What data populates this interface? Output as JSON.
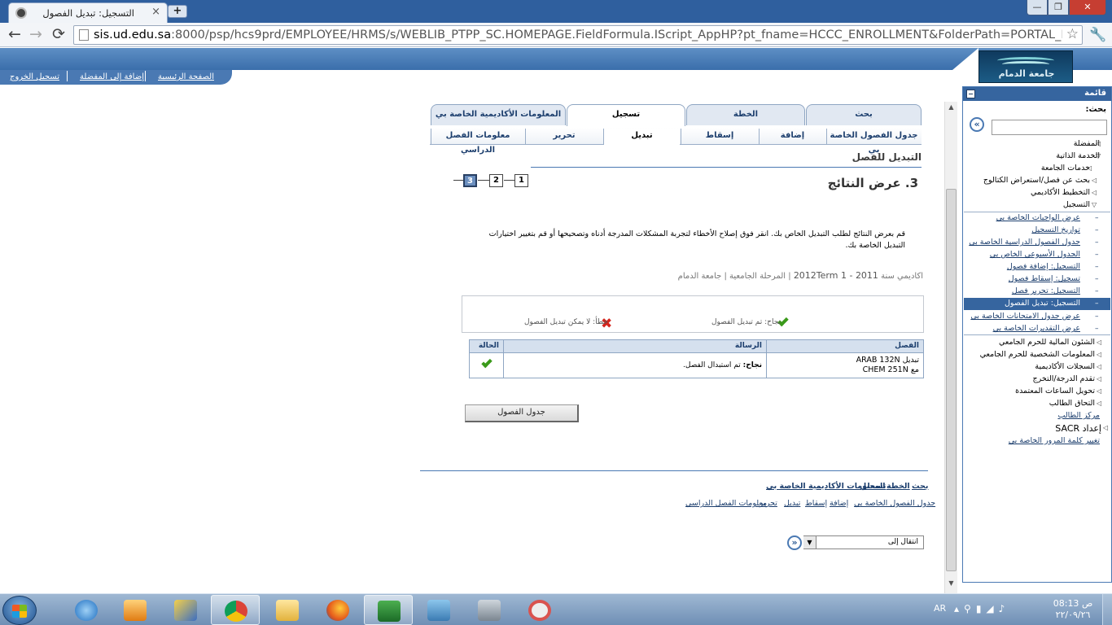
{
  "browser": {
    "tab_title": "التسجيل: تبديل الفصول",
    "new_tab": "+",
    "window_buttons": {
      "minimize": "—",
      "maximize": "❐",
      "close": "✕"
    },
    "url_host": "sis.ud.edu.sa",
    "url_rest": ":8000/psp/hcs9prd/EMPLOYEE/HRMS/s/WEBLIB_PTPP_SC.HOMEPAGE.FieldFormula.IScript_AppHP?pt_fname=HCCC_ENROLLMENT&FolderPath=PORTAL_ROOT_OBJECT",
    "nav": {
      "back": "←",
      "forward": "→",
      "reload": "⟳",
      "star": "☆",
      "wrench": "🔧"
    }
  },
  "header": {
    "logo_text": "جامعة الدمام",
    "links": {
      "home": "الصفحة الرئيسية",
      "add_favorite": "إضافة إلى المفضلة",
      "sign_out": "تسجيل الخروج"
    }
  },
  "tabs": {
    "top": [
      "بحث",
      "الخطة",
      "تسجيل",
      "المعلومات الأكاديمية الخاصة بي"
    ],
    "sub": [
      "جدول الفصول الخاصة بي",
      "إضافة",
      "إسقاط",
      "تبديل",
      "تحرير",
      "معلومات الفصل الدراسي"
    ]
  },
  "page": {
    "heading": "التبديل للفصل",
    "step_title": "3. عرض النتائج",
    "steps": [
      "1",
      "2",
      "3"
    ],
    "instructions": "قم بعرض النتائج لطلب التبديل الخاص بك. انقر فوق إصلاح الأخطاء لتجربة المشكلات المدرجة أدناه وتصحيحها أو قم بتغيير اختيارات التبديل الخاصة بك.",
    "term_prefix": "اكاديمي سنة",
    "term": "2011 - 2012Term 1",
    "career": "المرحلة الجامعية",
    "institution": "جامعة الدمام",
    "legend_success": "نجاح: تم تبديل الفصول",
    "legend_error": "خطأ: لا يمكن تبديل الفصول",
    "results_table": {
      "headers": {
        "class": "الفصل",
        "message": "الرسالة",
        "status": "الحالة"
      },
      "row": {
        "class_line1": "تبديل",
        "class_line1_code": "ARAB  132N",
        "class_line2": "مع",
        "class_line2_code": "CHEM  251N",
        "message_bold": "نجاح:",
        "message": "تم استبدال الفصل."
      }
    },
    "class_schedule_button": "جدول الفصول",
    "footer_links_row1": [
      "بحث",
      "الخطة",
      "تسجيل",
      "المعلومات الأكاديمية الخاصة بي"
    ],
    "footer_links_row2": [
      "جدول الفصول الخاصة بي",
      "إضافة",
      "إسقاط",
      "تبديل",
      "تحرير",
      "معلومات الفصل الدراسي"
    ],
    "goto_label": "انتقال إلى"
  },
  "menu": {
    "title": "قائمة",
    "search_label": "بحث:",
    "items_top": [
      "المفضلة",
      "الخدمة الذاتية",
      "خدمات الجامعة",
      "بحث عن فصل/استعراض الكتالوج",
      "التخطيط الأكاديمي",
      "التسجيل"
    ],
    "enrollment_sub": [
      "عرض الواجبات الخاصة بي",
      "تواريخ التسجيل",
      "جدول الفصول الدراسية الخاصة بي",
      "الجدول الأسبوعي الخاص بي",
      "التسجيل: إضافة فصول",
      "تسجيل: إسقاط فصول",
      "التسجيل: تحرير فصل",
      "التسجيل: تبديل الفصول",
      "عرض جدول الامتحانات الخاصة بي",
      "عرض التقديرات الخاصة بي"
    ],
    "items_bottom": [
      "الشئون المالية للحرم الجامعي",
      "المعلومات الشخصية للحرم الجامعي",
      "السجلات الأكاديمية",
      "تقدم الدرجة/التخرج",
      "تحويل الساعات المعتمدة",
      "التحاق الطالب"
    ],
    "student_center": "مركز الطالب",
    "sacr_setup": "إعداد SACR",
    "change_password": "تغيير كلمة المرور الخاصة بي"
  },
  "taskbar": {
    "lang": "AR",
    "clock_ampm": "ص",
    "clock_time": "08:13",
    "clock_date": "٢٢/٠٩/٢٦"
  }
}
